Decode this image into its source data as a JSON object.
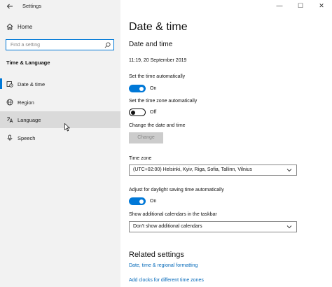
{
  "window": {
    "app_title": "Settings",
    "controls": {
      "minimize": "—",
      "maximize": "☐",
      "close": "✕"
    }
  },
  "sidebar": {
    "home_label": "Home",
    "search_placeholder": "Find a setting",
    "section_heading": "Time & Language",
    "items": [
      {
        "label": "Date & time",
        "icon": "calendar-clock-icon",
        "selected": true
      },
      {
        "label": "Region",
        "icon": "globe-icon",
        "selected": false
      },
      {
        "label": "Language",
        "icon": "language-icon",
        "selected": false,
        "hovered": true
      },
      {
        "label": "Speech",
        "icon": "microphone-icon",
        "selected": false
      }
    ]
  },
  "main": {
    "page_title": "Date & time",
    "subtitle": "Date and time",
    "current_datetime": "11:19, 20 September 2019",
    "set_time_auto": {
      "label": "Set the time automatically",
      "state": "On"
    },
    "set_timezone_auto": {
      "label": "Set the time zone automatically",
      "state": "Off"
    },
    "change_date": {
      "label": "Change the date and time",
      "button": "Change"
    },
    "time_zone": {
      "label": "Time zone",
      "value": "(UTC+02:00) Helsinki, Kyiv, Riga, Sofia, Tallinn, Vilnius"
    },
    "daylight_saving": {
      "label": "Adjust for daylight saving time automatically",
      "state": "On"
    },
    "additional_calendars": {
      "label": "Show additional calendars in the taskbar",
      "value": "Don't show additional calendars"
    },
    "related": {
      "heading": "Related settings",
      "links": [
        "Date, time & regional formatting",
        "Add clocks for different time zones"
      ]
    }
  },
  "colors": {
    "accent": "#0078d7",
    "link": "#0067b8",
    "sidebar_bg": "#f2f2f2",
    "hover_bg": "#dadada"
  }
}
